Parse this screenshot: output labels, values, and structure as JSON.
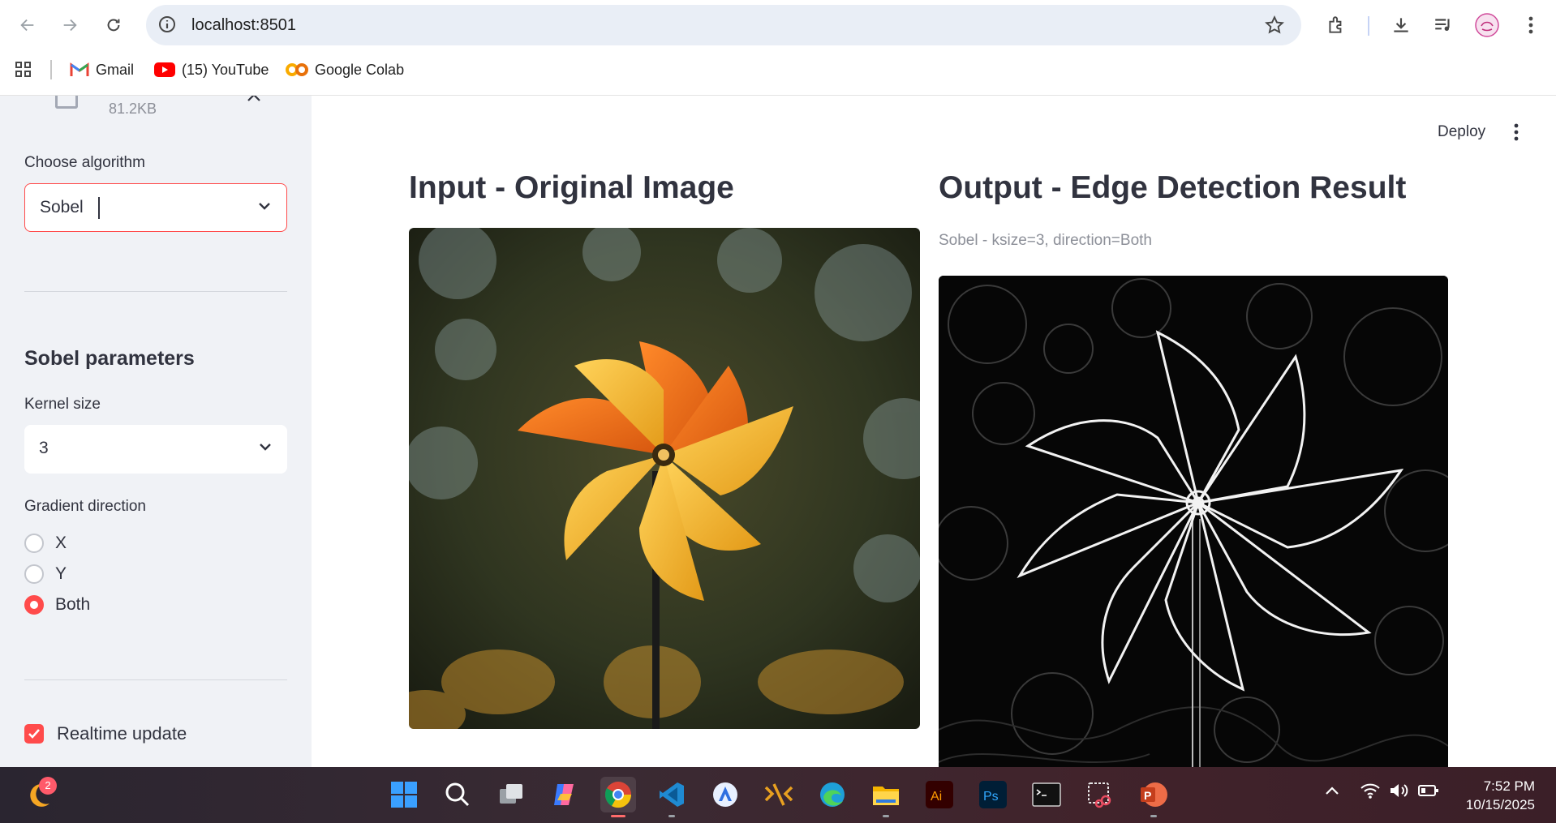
{
  "browser": {
    "url": "localhost:8501",
    "bookmarks": [
      {
        "label": "Gmail",
        "icon": "gmail-icon"
      },
      {
        "label": "(15) YouTube",
        "icon": "youtube-icon"
      },
      {
        "label": "Google Colab",
        "icon": "colab-icon"
      }
    ]
  },
  "sidebar": {
    "file_size": "81.2KB",
    "algorithm_label": "Choose algorithm",
    "algorithm_value": "Sobel",
    "params_heading": "Sobel parameters",
    "kernel_label": "Kernel size",
    "kernel_value": "3",
    "direction_label": "Gradient direction",
    "direction_options": [
      "X",
      "Y",
      "Both"
    ],
    "direction_selected": "Both",
    "realtime_label": "Realtime update",
    "realtime_checked": true
  },
  "main": {
    "deploy_label": "Deploy",
    "input_heading": "Input - Original Image",
    "output_heading": "Output - Edge Detection Result",
    "output_caption": "Sobel - ksize=3, direction=Both"
  },
  "taskbar": {
    "weather_badge": "2",
    "time": "7:52 PM",
    "date": "10/15/2025",
    "apps": [
      "start-icon",
      "search-icon",
      "task-view-icon",
      "copilot-icon",
      "chrome-icon",
      "vscode-icon",
      "app-store-icon",
      "bridge-icon",
      "edge-icon",
      "file-explorer-icon",
      "illustrator-icon",
      "photoshop-icon",
      "terminal-icon",
      "snipping-tool-icon",
      "powerpoint-icon"
    ]
  },
  "colors": {
    "accent": "#ff4b4b",
    "sidebar_bg": "#f0f2f6",
    "text": "#31333f"
  }
}
